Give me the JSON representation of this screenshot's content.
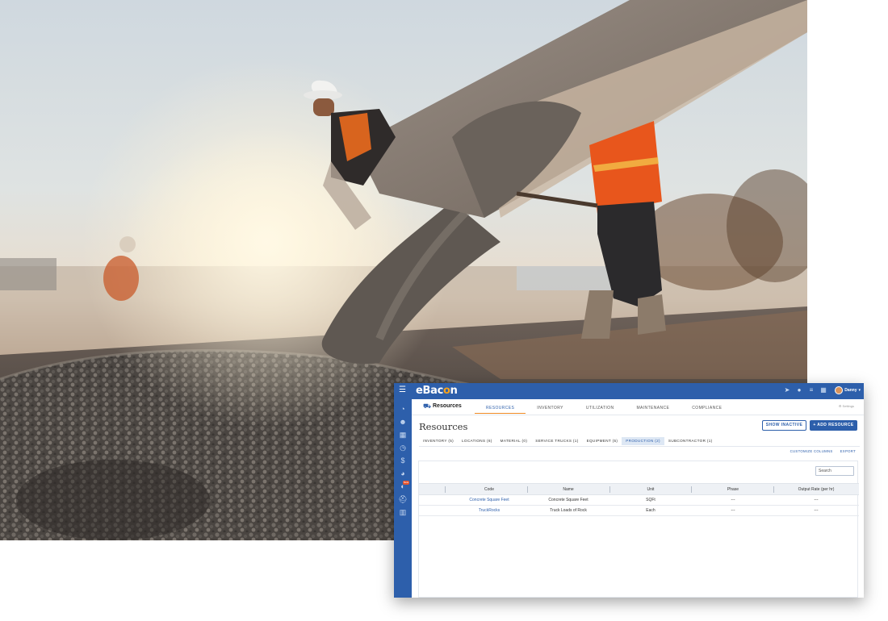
{
  "app": {
    "brand": {
      "text": "eBac",
      "accent": "o",
      "tail": "n"
    },
    "user_name": "Danny",
    "colors": {
      "primary": "#2d5fab",
      "accent": "#f08a24",
      "badge": "#e8542c"
    },
    "topbar_icons": [
      "location-icon",
      "pin-icon",
      "list-icon",
      "calendar-icon"
    ],
    "sidenav_icons": [
      "dashboard-icon",
      "people-icon",
      "calendar-icon",
      "clock-icon",
      "dollar-icon",
      "pie-chart-icon",
      "truck-icon",
      "hardhat-icon",
      "building-icon"
    ],
    "sidenav_badge": "New"
  },
  "subheader": {
    "section_label": "Resources",
    "tabs": [
      "RESOURCES",
      "INVENTORY",
      "UTILIZATION",
      "MAINTENANCE",
      "COMPLIANCE"
    ],
    "active_tab": "RESOURCES",
    "settings_label": "Settings"
  },
  "page": {
    "title": "Resources",
    "show_inactive_label": "SHOW INACTIVE",
    "add_resource_label": "+ ADD RESOURCE"
  },
  "category_tabs": [
    {
      "label": "INVENTORY (5)"
    },
    {
      "label": "LOCATIONS (6)"
    },
    {
      "label": "MATERIAL (0)"
    },
    {
      "label": "SERVICE TRUCKS (1)"
    },
    {
      "label": "EQUIPMENT (5)"
    },
    {
      "label": "PRODUCTION (2)"
    },
    {
      "label": "SUBCONTRACTOR (1)"
    }
  ],
  "active_category": "PRODUCTION (2)",
  "actions": {
    "customize_columns": "CUSTOMIZE COLUMNS",
    "export": "EXPORT"
  },
  "search": {
    "placeholder": "Search"
  },
  "table": {
    "columns": [
      "Code",
      "Name",
      "Unit",
      "Phase",
      "Output Rate (per hr)"
    ],
    "rows": [
      {
        "code": "Concrete Square Feet",
        "name": "Concrete Square Feet",
        "unit": "SQFt",
        "phase": "---",
        "output_rate": "---"
      },
      {
        "code": "TruckRocks",
        "name": "Truck Loads of Rock",
        "unit": "Each",
        "phase": "---",
        "output_rate": "---"
      }
    ]
  }
}
